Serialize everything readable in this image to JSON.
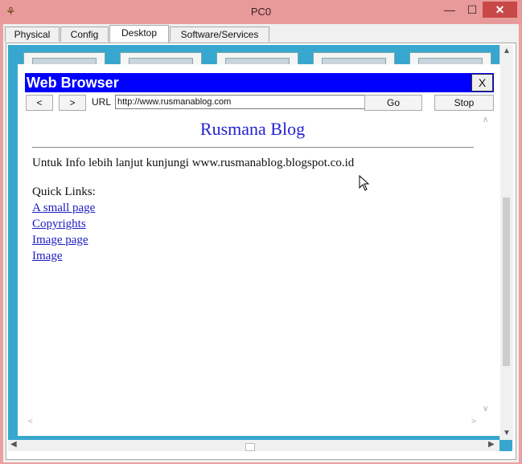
{
  "window": {
    "title": "PC0",
    "minimize": "—",
    "maximize": "☐",
    "close": "✕"
  },
  "tabs": [
    {
      "label": "Physical"
    },
    {
      "label": "Config"
    },
    {
      "label": "Desktop"
    },
    {
      "label": "Software/Services"
    }
  ],
  "active_tab": "Desktop",
  "browser": {
    "title": "Web Browser",
    "close_label": "X",
    "back_label": "<",
    "forward_label": ">",
    "url_label": "URL",
    "url_value": "http://www.rusmanablog.com",
    "go_label": "Go",
    "stop_label": "Stop"
  },
  "page": {
    "title": "Rusmana Blog",
    "info": "Untuk Info lebih lanjut kunjungi www.rusmanablog.blogspot.co.id",
    "quick_links_label": "Quick Links:",
    "links": [
      {
        "text": "A small page"
      },
      {
        "text": "Copyrights"
      },
      {
        "text": "Image page"
      },
      {
        "text": "Image"
      }
    ]
  },
  "colors": {
    "titlebar": "#e89a9a",
    "browser_bar": "#0000ff",
    "desktop_bg": "#37a7cf",
    "link": "#1c1cc3",
    "page_title": "#2323cf"
  }
}
